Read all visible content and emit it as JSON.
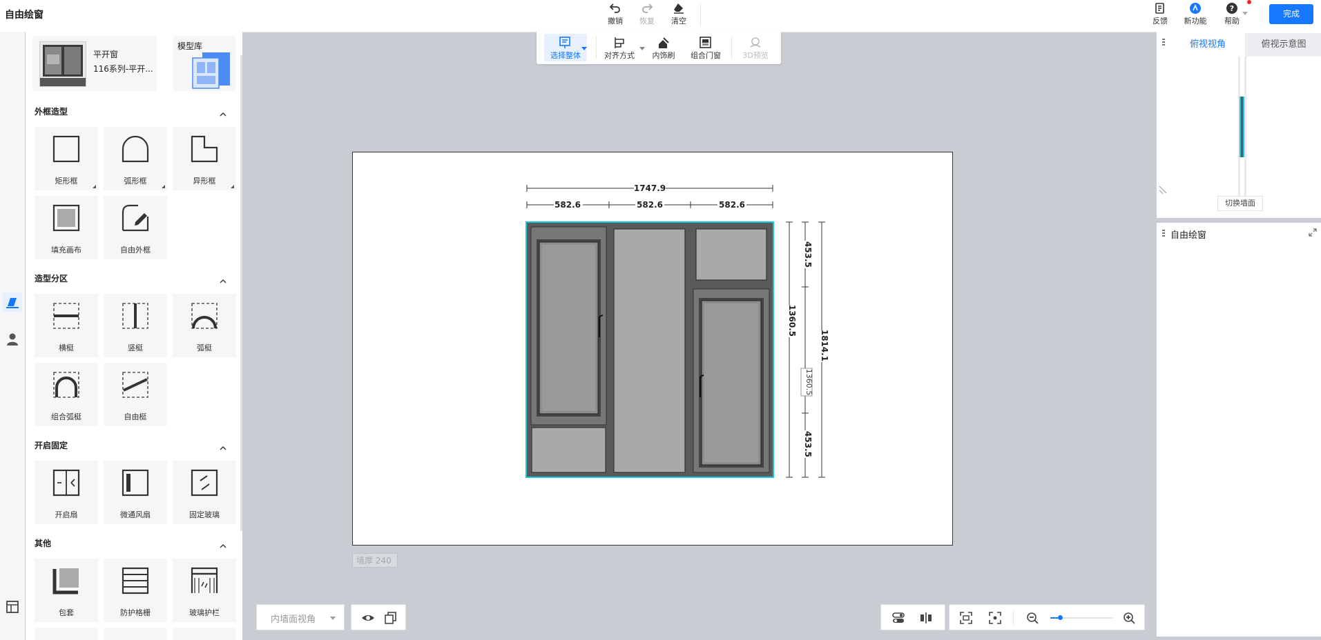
{
  "app": {
    "title": "自由绘窗"
  },
  "toolbar": {
    "undo": "撤销",
    "redo": "恢复",
    "clear": "清空",
    "feedback": "反馈",
    "new_feature": "新功能",
    "help": "帮助",
    "done": "完成"
  },
  "model": {
    "name": "平开窗",
    "series": "116系列-平开...",
    "library": "模型库"
  },
  "sections": {
    "outer_frame": {
      "title": "外框造型",
      "items": [
        "矩形框",
        "弧形框",
        "异形框",
        "填充画布",
        "自由外框"
      ]
    },
    "partition": {
      "title": "造型分区",
      "items": [
        "横梃",
        "竖梃",
        "弧梃",
        "组合弧梃",
        "自由梃"
      ]
    },
    "opening": {
      "title": "开启固定",
      "items": [
        "开启扇",
        "微通风扇",
        "固定玻璃"
      ]
    },
    "other": {
      "title": "其他",
      "items": [
        "包套",
        "防护格栅",
        "玻璃护栏"
      ]
    }
  },
  "canvas_toolbar": {
    "select_all": "选择整体",
    "align": "对齐方式",
    "trim_brush": "内饰刷",
    "combo": "组合门窗",
    "preview_3d": "3D预览"
  },
  "dimensions": {
    "total_width": "1747.9",
    "pane_widths": [
      "582.6",
      "582.6",
      "582.6"
    ],
    "top_height": "453.5",
    "mid_height": "1360.5",
    "bottom_height": "453.5",
    "total_height": "1814.1",
    "edit_value": "1360.5"
  },
  "wall_thickness": "墙厚 240",
  "bottom_bar": {
    "view_mode": "内墙面视角"
  },
  "right_panel": {
    "tabs": [
      "俯视视角",
      "俯视示意图"
    ],
    "switch_wall": "切换墙面",
    "panel_title": "自由绘窗"
  },
  "colors": {
    "accent": "#1677ff",
    "selection": "#19c8e0",
    "frame": "#5a5a5a",
    "glass": "#a9a9a9"
  }
}
